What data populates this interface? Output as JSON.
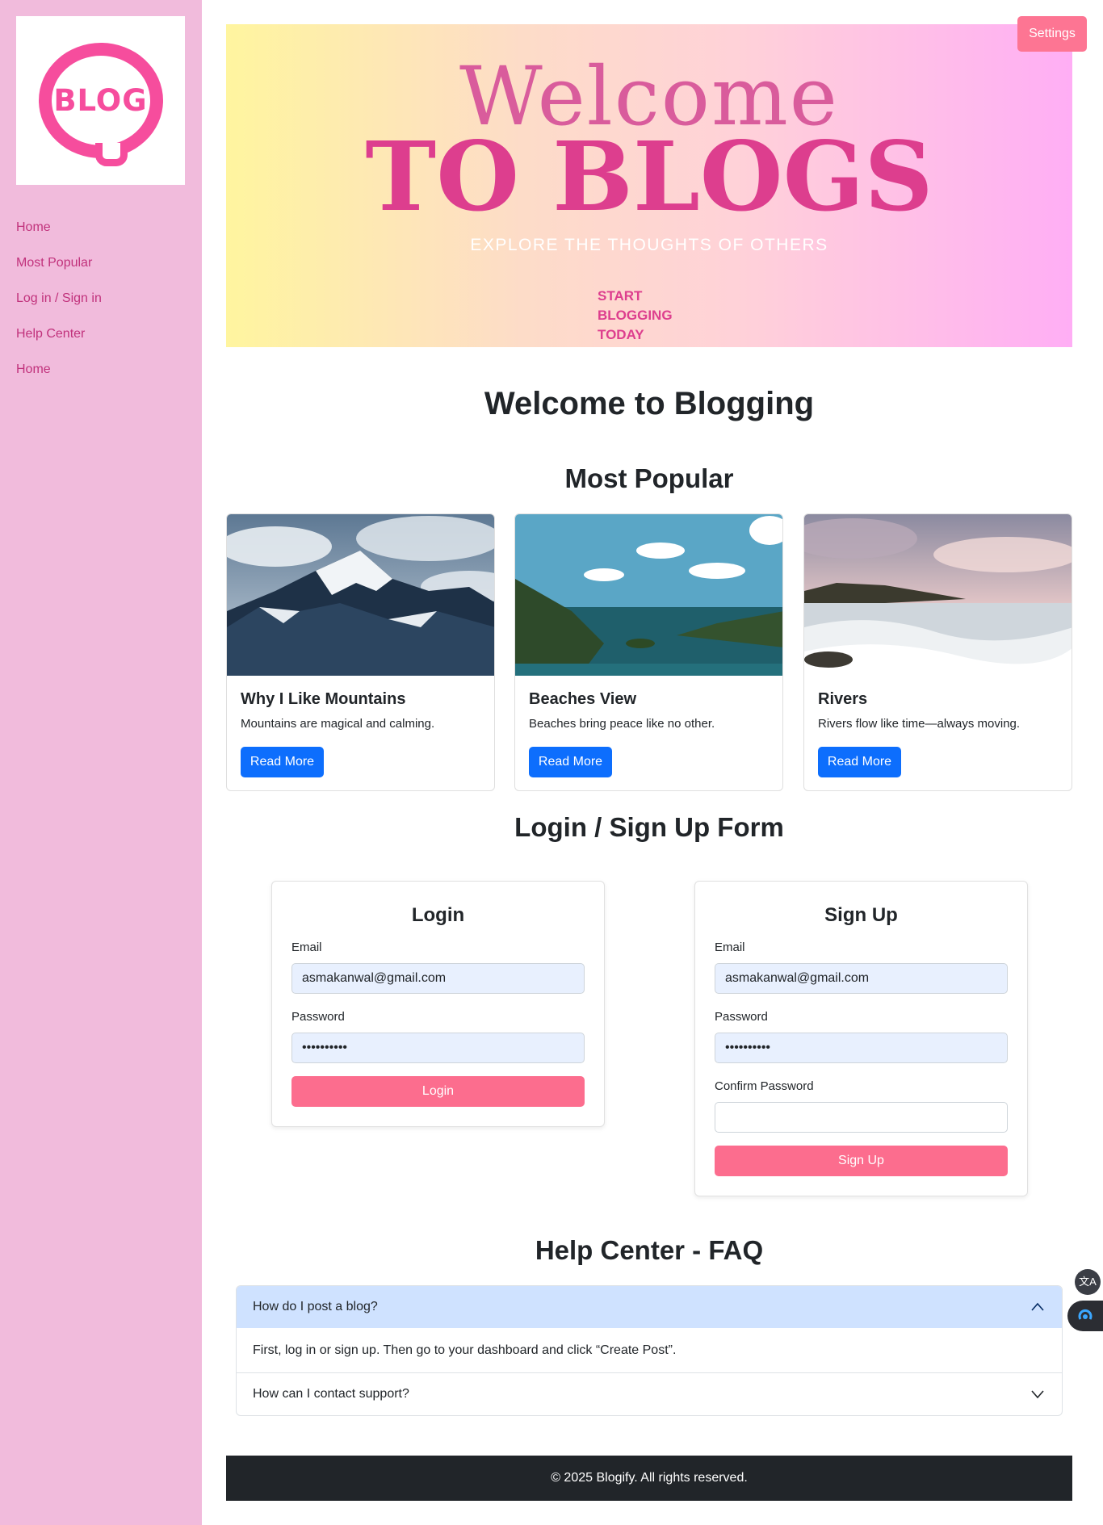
{
  "logo": {
    "text": "BLOG"
  },
  "nav": {
    "items": [
      {
        "label": "Home"
      },
      {
        "label": "Most Popular"
      },
      {
        "label": "Log in / Sign in"
      },
      {
        "label": "Help Center"
      },
      {
        "label": "Home"
      }
    ]
  },
  "settings_label": "Settings",
  "hero": {
    "welcome": "Welcome",
    "title": "TO BLOGS",
    "subtitle": "EXPLORE THE THOUGHTS OF OTHERS",
    "cta_lines": [
      "START",
      "BLOGGING",
      "TODAY"
    ]
  },
  "headings": {
    "welcome": "Welcome to Blogging",
    "popular": "Most Popular",
    "form": "Login / Sign Up Form",
    "faq": "Help Center - FAQ"
  },
  "cards": [
    {
      "title": "Why I Like Mountains",
      "text": "Mountains are magical and calming.",
      "button": "Read More"
    },
    {
      "title": "Beaches View",
      "text": "Beaches bring peace like no other.",
      "button": "Read More"
    },
    {
      "title": "Rivers",
      "text": "Rivers flow like time—always moving.",
      "button": "Read More"
    }
  ],
  "login": {
    "title": "Login",
    "email_label": "Email",
    "email_value": "asmakanwal@gmail.com",
    "password_label": "Password",
    "password_value": "••••••••••",
    "button": "Login"
  },
  "signup": {
    "title": "Sign Up",
    "email_label": "Email",
    "email_value": "asmakanwal@gmail.com",
    "password_label": "Password",
    "password_value": "••••••••••",
    "confirm_label": "Confirm Password",
    "confirm_value": "",
    "button": "Sign Up"
  },
  "faq": [
    {
      "question": "How do I post a blog?",
      "answer": "First, log in or sign up. Then go to your dashboard and click “Create Post”.",
      "expanded": true
    },
    {
      "question": "How can I contact support?",
      "expanded": false
    }
  ],
  "footer": {
    "text": "© 2025 Blogify. All rights reserved."
  },
  "colors": {
    "sidebar": "#f1bbdc",
    "brand_pink": "#f64d9d",
    "accent_button": "#fc6d8e",
    "primary_button": "#0d6efd",
    "footer_bg": "#212529"
  },
  "icons": [
    "chevron-up-icon",
    "chevron-down-icon",
    "translate-icon",
    "assistant-icon"
  ]
}
